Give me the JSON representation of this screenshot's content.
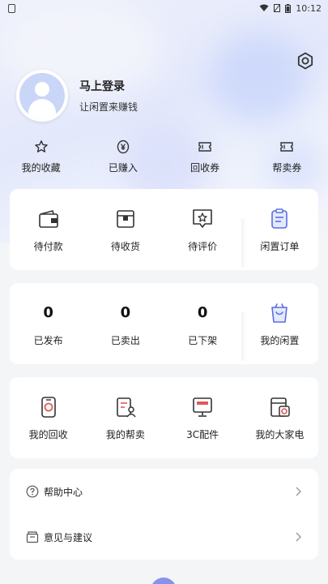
{
  "status_bar": {
    "time": "10:12"
  },
  "profile": {
    "title": "马上登录",
    "subtitle": "让闲置来赚钱"
  },
  "quick_links": [
    {
      "label": "我的收藏",
      "icon": "star-icon"
    },
    {
      "label": "已赚入",
      "icon": "yen-coin-icon"
    },
    {
      "label": "回收券",
      "icon": "ticket-icon"
    },
    {
      "label": "帮卖券",
      "icon": "ticket-icon"
    }
  ],
  "orders": {
    "items": [
      {
        "label": "待付款",
        "icon": "wallet-icon"
      },
      {
        "label": "待收货",
        "icon": "package-icon"
      },
      {
        "label": "待评价",
        "icon": "review-icon"
      }
    ],
    "highlight": {
      "label": "闲置订单",
      "icon": "order-list-icon"
    }
  },
  "listings": {
    "items": [
      {
        "label": "已发布",
        "count": "0"
      },
      {
        "label": "已卖出",
        "count": "0"
      },
      {
        "label": "已下架",
        "count": "0"
      }
    ],
    "highlight": {
      "label": "我的闲置",
      "icon": "shopping-bag-icon"
    }
  },
  "services": [
    {
      "label": "我的回收",
      "icon": "recycle-phone-icon"
    },
    {
      "label": "我的帮卖",
      "icon": "sell-doc-icon"
    },
    {
      "label": "3C配件",
      "icon": "monitor-icon"
    },
    {
      "label": "我的大家电",
      "icon": "appliance-icon"
    }
  ],
  "menu": [
    {
      "label": "帮助中心",
      "icon": "help-circle-icon"
    },
    {
      "label": "意见与建议",
      "icon": "feedback-box-icon"
    }
  ],
  "colors": {
    "accent": "#6b7be7",
    "background": "#f4f5f7"
  }
}
